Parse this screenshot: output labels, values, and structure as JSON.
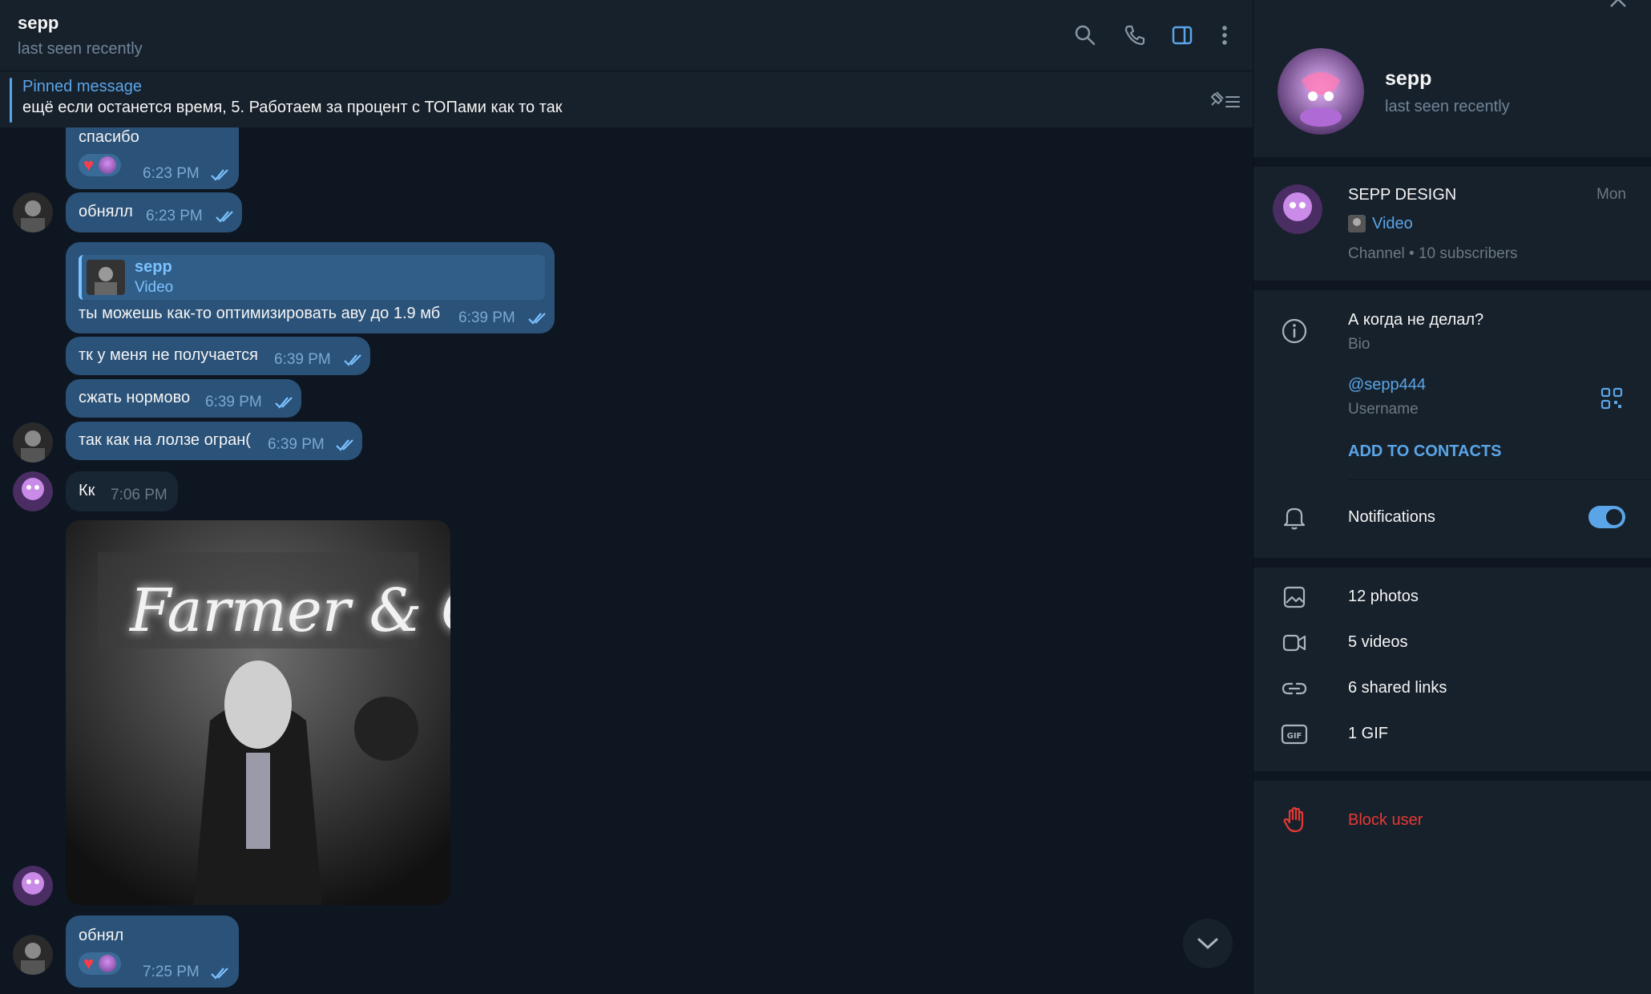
{
  "chat": {
    "title": "sepp",
    "status": "last seen recently",
    "pinned": {
      "label": "Pinned message",
      "text": "ещё если останется время,  5. Работаем за процент с ТОПами как то так"
    },
    "messages": [
      {
        "text": "спасибо",
        "time": "6:23 PM",
        "reaction": "♥"
      },
      {
        "text": "обнялл",
        "time": "6:23 PM"
      },
      {
        "reply_name": "sepp",
        "reply_sub": "Video",
        "text": "ты можешь как-то оптимизировать аву до 1.9 мб",
        "time": "6:39 PM"
      },
      {
        "text": "тк у меня не получается",
        "time": "6:39 PM"
      },
      {
        "text": "сжать нормово",
        "time": "6:39 PM"
      },
      {
        "text": "так как на лолзе огран(",
        "time": "6:39 PM"
      },
      {
        "text": "Кк",
        "time": "7:06 PM"
      },
      {
        "text": "обнял",
        "time": "7:25 PM",
        "reaction": "♥"
      }
    ],
    "video_caption": "Farmer & Co."
  },
  "panel": {
    "name": "sepp",
    "status": "last seen recently",
    "channel": {
      "name": "SEPP DESIGN",
      "day": "Mon",
      "last": "Video",
      "meta": "Channel • 10 subscribers"
    },
    "bio": {
      "text": "А когда не делал?",
      "label": "Bio"
    },
    "username": {
      "value": "@sepp444",
      "label": "Username"
    },
    "add_contact": "ADD TO CONTACTS",
    "notifications": "Notifications",
    "media": {
      "photos": "12 photos",
      "videos": "5 videos",
      "links": "6 shared links",
      "gifs": "1 GIF"
    },
    "block": "Block user"
  },
  "colors": {
    "accent": "#5aa5e8",
    "danger": "#e53935",
    "bubble_out": "#2b5278",
    "bubble_in": "#182533"
  }
}
